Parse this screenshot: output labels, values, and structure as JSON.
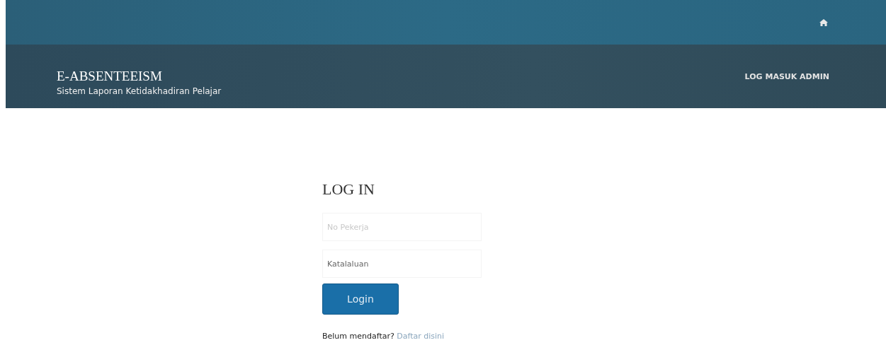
{
  "header": {
    "title": "E-ABSENTEEISM",
    "subtitle": "Sistem Laporan Ketidakhadiran Pelajar",
    "nav_link": "LOG MASUK ADMIN"
  },
  "login": {
    "heading": "LOG IN",
    "fields": [
      {
        "kind": "text",
        "placeholder": "No Pekerja"
      },
      {
        "kind": "password",
        "placeholder": "Katalaluan"
      }
    ],
    "button": "Login",
    "prompt": "Belum mendaftar?",
    "register_link": "Daftar disini"
  }
}
